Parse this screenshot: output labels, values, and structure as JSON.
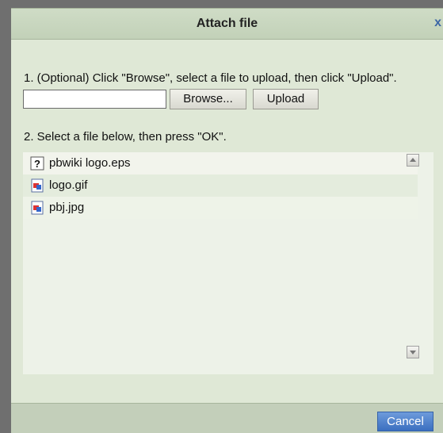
{
  "dialog": {
    "title": "Attach file",
    "close_label": "x"
  },
  "step1": {
    "text": "1. (Optional) Click \"Browse\", select a file to upload, then click \"Upload\".",
    "file_value": "",
    "browse_label": "Browse...",
    "upload_label": "Upload"
  },
  "step2": {
    "text": "2. Select a file below, then press \"OK\"."
  },
  "files": [
    {
      "name": "pbwiki logo.eps",
      "icon": "unknown-file-icon"
    },
    {
      "name": "logo.gif",
      "icon": "image-file-icon"
    },
    {
      "name": "pbj.jpg",
      "icon": "image-file-icon"
    }
  ],
  "footer": {
    "cancel_label": "Cancel"
  },
  "colors": {
    "titlebar": "#c2d1b8",
    "dialog_bg": "#dfe8d6",
    "cancel_bg": "#3b6fc0"
  }
}
